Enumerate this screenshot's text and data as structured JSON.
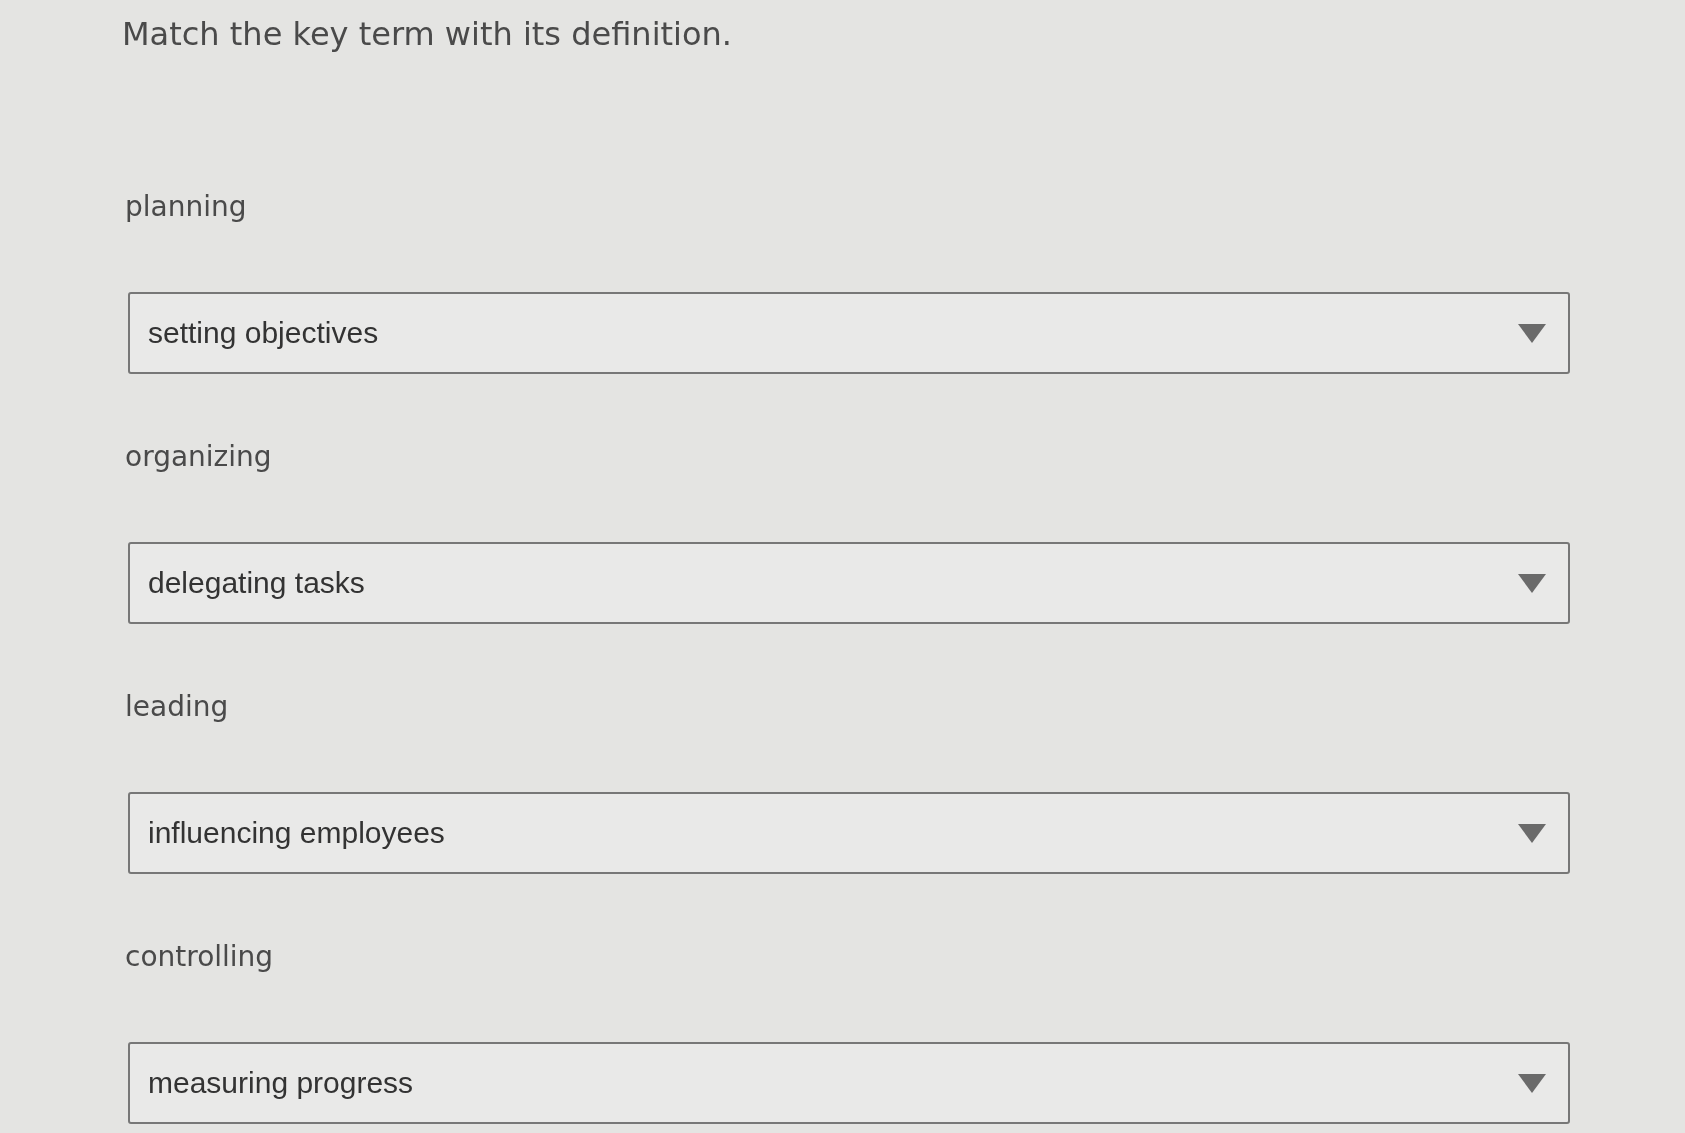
{
  "instruction": "Match the key term with its definition.",
  "items": [
    {
      "term": "planning",
      "selection": "setting objectives"
    },
    {
      "term": "organizing",
      "selection": "delegating tasks"
    },
    {
      "term": "leading",
      "selection": "influencing employees"
    },
    {
      "term": "controlling",
      "selection": "measuring progress"
    }
  ]
}
